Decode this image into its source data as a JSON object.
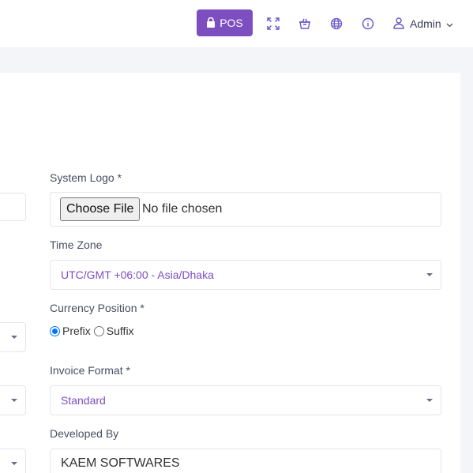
{
  "header": {
    "pos_label": "POS",
    "user_name": "Admin",
    "icons": [
      "shopping-bag-icon",
      "fullscreen-icon",
      "basket-icon",
      "globe-icon",
      "info-icon",
      "user-icon",
      "chevron-down-icon"
    ]
  },
  "form": {
    "system_logo": {
      "label": "System Logo *",
      "button": "Choose File",
      "status": "No file chosen"
    },
    "time_zone": {
      "label": "Time Zone",
      "value": "UTC/GMT +06:00 - Asia/Dhaka"
    },
    "currency_position": {
      "label": "Currency Position *",
      "options": [
        "Prefix",
        "Suffix"
      ],
      "selected": "Prefix"
    },
    "invoice_format": {
      "label": "Invoice Format *",
      "value": "Standard"
    },
    "developed_by": {
      "label": "Developed By",
      "value": "KAEM SOFTWARES"
    }
  },
  "colors": {
    "accent": "#7c4ebf",
    "radio_checked": "#0075ff",
    "background": "#f4f5f8"
  }
}
